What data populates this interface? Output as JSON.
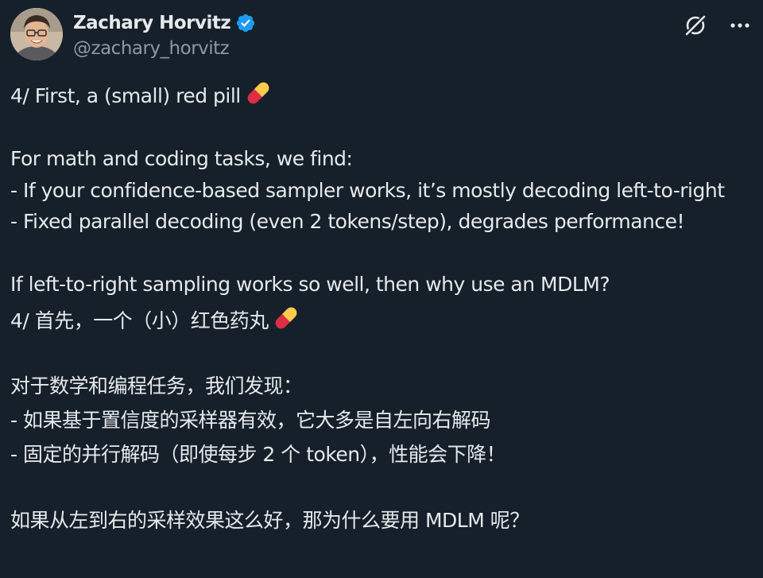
{
  "author": {
    "name": "Zachary Horvitz",
    "handle": "@zachary_horvitz"
  },
  "icons": {
    "verified": "verified-badge-icon",
    "grok": "grok-icon",
    "more": "more-icon",
    "pill": "pill-emoji"
  },
  "colors": {
    "background": "#15202b",
    "text": "#e7e9ea",
    "secondary_text": "#8b98a5",
    "verified_blue": "#1d9bf0"
  },
  "tweet": {
    "en_line1": "4/ First, a (small) red pill",
    "en_line2": "For math and coding tasks, we find:",
    "en_line3": "- If your confidence-based sampler works, it’s mostly decoding left-to-right",
    "en_line4": "- Fixed parallel decoding (even 2 tokens/step), degrades performance!",
    "en_line5": "If left-to-right sampling works so well, then why use an MDLM?",
    "zh_line1": "4/ 首先，一个（小）红色药丸",
    "zh_line2": "对于数学和编程任务，我们发现：",
    "zh_line3": "- 如果基于置信度的采样器有效，它大多是自左向右解码",
    "zh_line4": "- 固定的并行解码（即使每步 2 个 token），性能会下降！",
    "zh_line5": "如果从左到右的采样效果这么好，那为什么要用 MDLM 呢？"
  }
}
